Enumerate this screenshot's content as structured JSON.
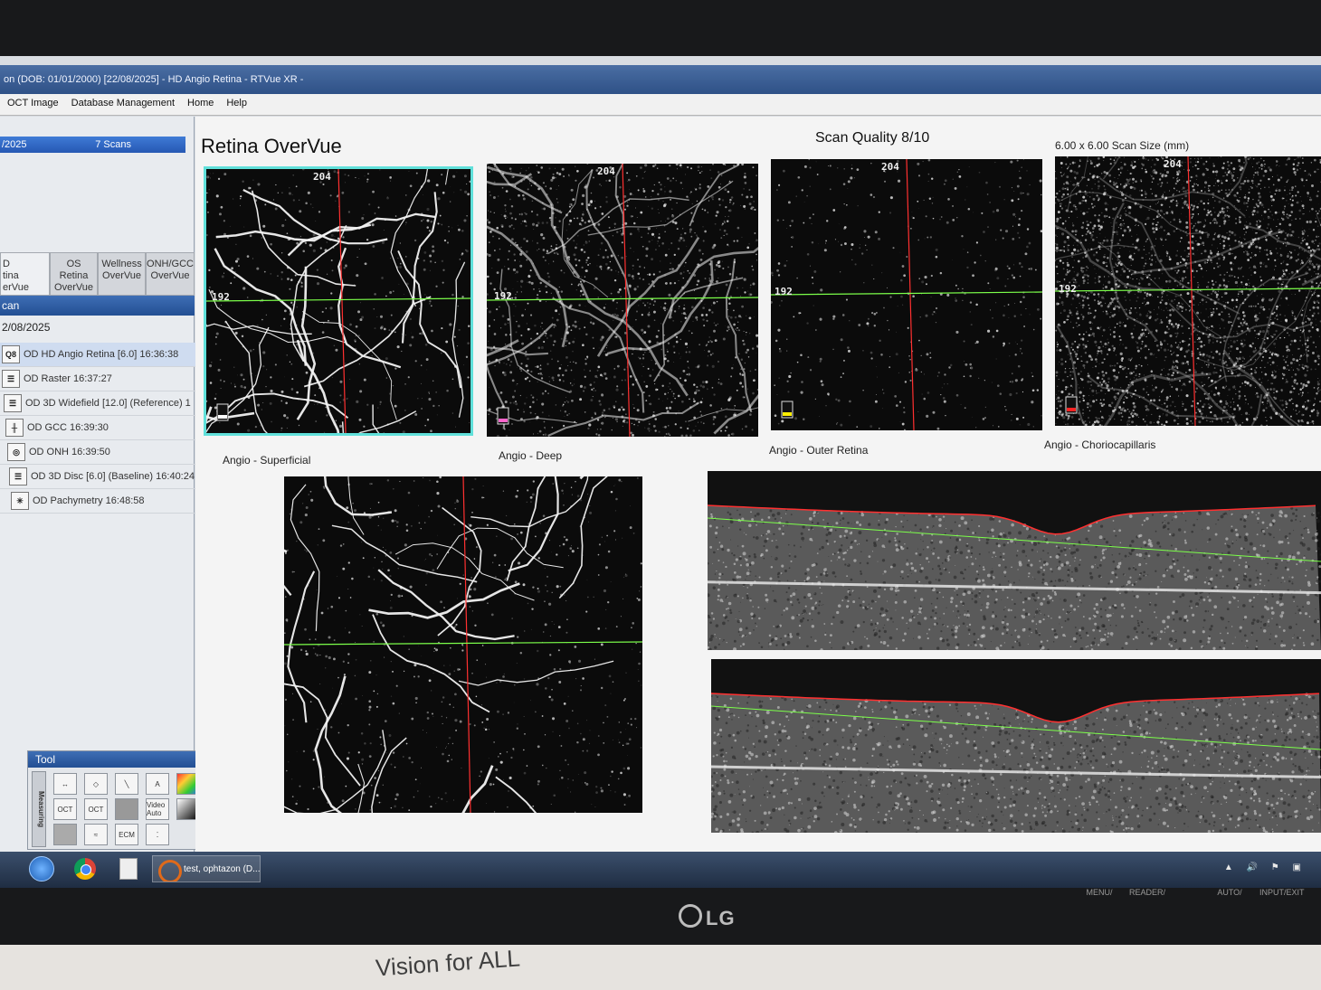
{
  "window": {
    "title": "on  (DOB: 01/01/2000)  [22/08/2025] - HD Angio Retina - RTVue XR -"
  },
  "menu": [
    "OCT Image",
    "Database Management",
    "Home",
    "Help"
  ],
  "sidebar": {
    "selected_visit": {
      "date": "/2025",
      "scans": "7 Scans"
    },
    "tabs": [
      "D\ntina\nerVue",
      "OS\nRetina\nOverVue",
      "Wellness\nOverVue",
      "ONH/GCC\nOverVue"
    ],
    "header": "can",
    "date": "2/08/2025",
    "scans": [
      {
        "icon": "Q8",
        "label": "OD HD Angio Retina [6.0]  16:36:38"
      },
      {
        "icon": "",
        "label": "OD Raster  16:37:27"
      },
      {
        "icon": "",
        "label": "OD 3D Widefield [12.0] (Reference)  1"
      },
      {
        "icon": "",
        "label": "OD GCC  16:39:30"
      },
      {
        "icon": "",
        "label": "OD ONH  16:39:50"
      },
      {
        "icon": "",
        "label": "OD 3D Disc [6.0] (Baseline)  16:40:24"
      },
      {
        "icon": "",
        "label": "OD Pachymetry  16:48:58"
      }
    ]
  },
  "tool": {
    "header": "Tool",
    "side_label": "Measuring",
    "buttons": [
      "",
      "",
      "",
      "A",
      "",
      "",
      "OCT",
      "OCT",
      "",
      "Video Auto",
      "",
      "",
      "",
      "",
      "ECM",
      ""
    ]
  },
  "main": {
    "title": "Retina OverVue",
    "scan_quality": "Scan Quality 8/10",
    "scan_size": "6.00 x 6.00 Scan Size (mm)",
    "panels": [
      {
        "caption": "Angio - Superficial",
        "top_num": "204",
        "left_num": "192",
        "badge": "#ffffff"
      },
      {
        "caption": "Angio - Deep",
        "top_num": "204",
        "left_num": "192",
        "badge": "#ff66cc"
      },
      {
        "caption": "Angio - Outer Retina",
        "top_num": "204",
        "left_num": "192",
        "badge": "#ffee00"
      },
      {
        "caption": "Angio - Choriocapillaris",
        "top_num": "204",
        "left_num": "192",
        "badge": "#ff2222"
      }
    ]
  },
  "taskbar": {
    "app_label": "test, ophtazon  (D..."
  },
  "monitor": {
    "brand": "LG",
    "buttons": [
      "MENU/",
      "READER/",
      "",
      "AUTO/",
      "INPUT/EXIT"
    ]
  },
  "wall": {
    "tagline": "Vision for ALL"
  },
  "colors": {
    "accent": "#2658b3",
    "selection_outline": "#60e0da",
    "crosshair_red": "#ff3030",
    "crosshair_green": "#7cff4a"
  }
}
